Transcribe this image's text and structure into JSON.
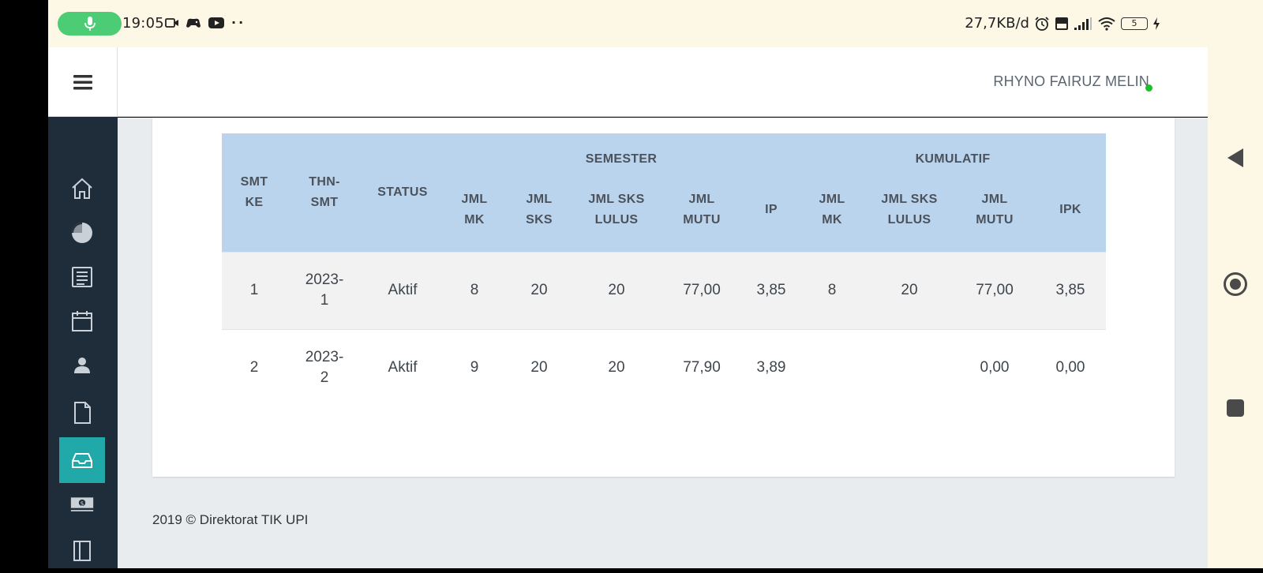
{
  "status_bar": {
    "time": "19:05",
    "network_speed": "27,7KB/d",
    "battery_level": "5",
    "left_icons": [
      "mic-icon",
      "video-recording-icon",
      "game-controller-icon",
      "youtube-icon",
      "more-dots-icon"
    ],
    "right_icons": [
      "alarm-icon",
      "volte-icon",
      "signal-icon",
      "wifi-icon",
      "battery-icon",
      "charging-icon"
    ]
  },
  "header": {
    "user_name": "RHYNO FAIRUZ MELIN",
    "online_color": "#1dbf2a"
  },
  "sidebar": {
    "items": [
      {
        "icon": "home-icon",
        "active": false
      },
      {
        "icon": "pie-chart-icon",
        "active": false
      },
      {
        "icon": "newspaper-icon",
        "active": false
      },
      {
        "icon": "calendar-icon",
        "active": false
      },
      {
        "icon": "user-icon",
        "active": false
      },
      {
        "icon": "document-icon",
        "active": true
      },
      {
        "icon": "inbox-icon",
        "active": false
      },
      {
        "icon": "money-icon",
        "active": false
      },
      {
        "icon": "book-icon",
        "active": false
      }
    ],
    "active_color": "#21a8a8"
  },
  "table": {
    "group_headers": {
      "semester": "SEMESTER",
      "kumulatif": "KUMULATIF"
    },
    "columns": [
      {
        "key": "smt_ke",
        "line1": "SMT",
        "line2": "KE"
      },
      {
        "key": "thn_smt",
        "line1": "THN-",
        "line2": "SMT"
      },
      {
        "key": "status",
        "line1": "STATUS",
        "line2": ""
      },
      {
        "key": "jml_mk",
        "line1": "JML",
        "line2": "MK"
      },
      {
        "key": "jml_sks",
        "line1": "JML",
        "line2": "SKS"
      },
      {
        "key": "jml_sks_lulus",
        "line1": "JML SKS",
        "line2": "LULUS"
      },
      {
        "key": "jml_mutu",
        "line1": "JML",
        "line2": "MUTU"
      },
      {
        "key": "ip",
        "line1": "IP",
        "line2": ""
      },
      {
        "key": "k_jml_mk",
        "line1": "JML",
        "line2": "MK"
      },
      {
        "key": "k_jml_sks_lulus",
        "line1": "JML SKS",
        "line2": "LULUS"
      },
      {
        "key": "k_jml_mutu",
        "line1": "JML",
        "line2": "MUTU"
      },
      {
        "key": "ipk",
        "line1": "IPK",
        "line2": ""
      }
    ],
    "rows": [
      {
        "smt_ke": "1",
        "thn_smt_1": "2023-",
        "thn_smt_2": "1",
        "status": "Aktif",
        "jml_mk": "8",
        "jml_sks": "20",
        "jml_sks_lulus": "20",
        "jml_mutu": "77,00",
        "ip": "3,85",
        "k_jml_mk": "8",
        "k_jml_sks_lulus": "20",
        "k_jml_mutu": "77,00",
        "ipk": "3,85"
      },
      {
        "smt_ke": "2",
        "thn_smt_1": "2023-",
        "thn_smt_2": "2",
        "status": "Aktif",
        "jml_mk": "9",
        "jml_sks": "20",
        "jml_sks_lulus": "20",
        "jml_mutu": "77,90",
        "ip": "3,89",
        "k_jml_mk": "",
        "k_jml_sks_lulus": "",
        "k_jml_mutu": "0,00",
        "ipk": "0,00"
      }
    ],
    "header_color": "#bad4ee"
  },
  "footer": {
    "text": "2019 © Direktorat TIK UPI"
  }
}
